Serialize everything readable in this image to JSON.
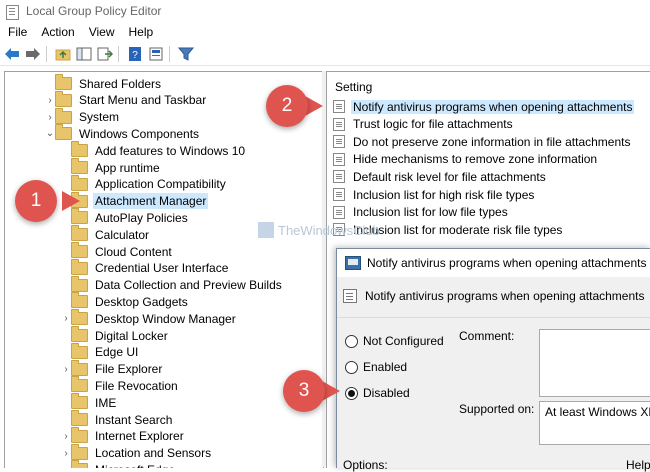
{
  "window": {
    "title": "Local Group Policy Editor"
  },
  "menu": [
    "File",
    "Action",
    "View",
    "Help"
  ],
  "toolbar_icons": [
    "back-arrow-icon",
    "forward-arrow-icon",
    "up-folder-icon",
    "show-hide-tree-icon",
    "export-list-icon",
    "help-icon",
    "properties-icon",
    "filter-icon"
  ],
  "tree": [
    {
      "label": "Shared Folders",
      "level": 1,
      "chevron": ""
    },
    {
      "label": "Start Menu and Taskbar",
      "level": 1,
      "chevron": "›"
    },
    {
      "label": "System",
      "level": 1,
      "chevron": "›"
    },
    {
      "label": "Windows Components",
      "level": 1,
      "chevron": "⌄"
    },
    {
      "label": "Add features to Windows 10",
      "level": 2,
      "chevron": ""
    },
    {
      "label": "App runtime",
      "level": 2,
      "chevron": ""
    },
    {
      "label": "Application Compatibility",
      "level": 2,
      "chevron": ""
    },
    {
      "label": "Attachment Manager",
      "level": 2,
      "chevron": "",
      "selected": true
    },
    {
      "label": "AutoPlay Policies",
      "level": 2,
      "chevron": ""
    },
    {
      "label": "Calculator",
      "level": 2,
      "chevron": ""
    },
    {
      "label": "Cloud Content",
      "level": 2,
      "chevron": ""
    },
    {
      "label": "Credential User Interface",
      "level": 2,
      "chevron": ""
    },
    {
      "label": "Data Collection and Preview Builds",
      "level": 2,
      "chevron": ""
    },
    {
      "label": "Desktop Gadgets",
      "level": 2,
      "chevron": ""
    },
    {
      "label": "Desktop Window Manager",
      "level": 2,
      "chevron": "›"
    },
    {
      "label": "Digital Locker",
      "level": 2,
      "chevron": ""
    },
    {
      "label": "Edge UI",
      "level": 2,
      "chevron": ""
    },
    {
      "label": "File Explorer",
      "level": 2,
      "chevron": "›"
    },
    {
      "label": "File Revocation",
      "level": 2,
      "chevron": ""
    },
    {
      "label": "IME",
      "level": 2,
      "chevron": ""
    },
    {
      "label": "Instant Search",
      "level": 2,
      "chevron": ""
    },
    {
      "label": "Internet Explorer",
      "level": 2,
      "chevron": "›"
    },
    {
      "label": "Location and Sensors",
      "level": 2,
      "chevron": "›"
    },
    {
      "label": "Microsoft Edge",
      "level": 2,
      "chevron": ""
    }
  ],
  "settings": {
    "column_header": "Setting",
    "items": [
      {
        "label": "Notify antivirus programs when opening attachments",
        "selected": true
      },
      {
        "label": "Trust logic for file attachments"
      },
      {
        "label": "Do not preserve zone information in file attachments"
      },
      {
        "label": "Hide mechanisms to remove zone information"
      },
      {
        "label": "Default risk level for file attachments"
      },
      {
        "label": "Inclusion list for high risk file types"
      },
      {
        "label": "Inclusion list for low file types"
      },
      {
        "label": "Inclusion list for moderate risk file types"
      }
    ]
  },
  "watermark": "TheWindowsClub",
  "dialog": {
    "title": "Notify antivirus programs when opening attachments",
    "subtitle": "Notify antivirus programs when opening attachments",
    "radios": [
      {
        "label": "Not Configured",
        "checked": false
      },
      {
        "label": "Enabled",
        "checked": false
      },
      {
        "label": "Disabled",
        "checked": true
      }
    ],
    "comment_label": "Comment:",
    "supported_label": "Supported on:",
    "supported_value": "At least Windows XP P",
    "options_label": "Options:",
    "help_label": "Help"
  },
  "badges": [
    {
      "number": "1"
    },
    {
      "number": "2"
    },
    {
      "number": "3"
    }
  ]
}
